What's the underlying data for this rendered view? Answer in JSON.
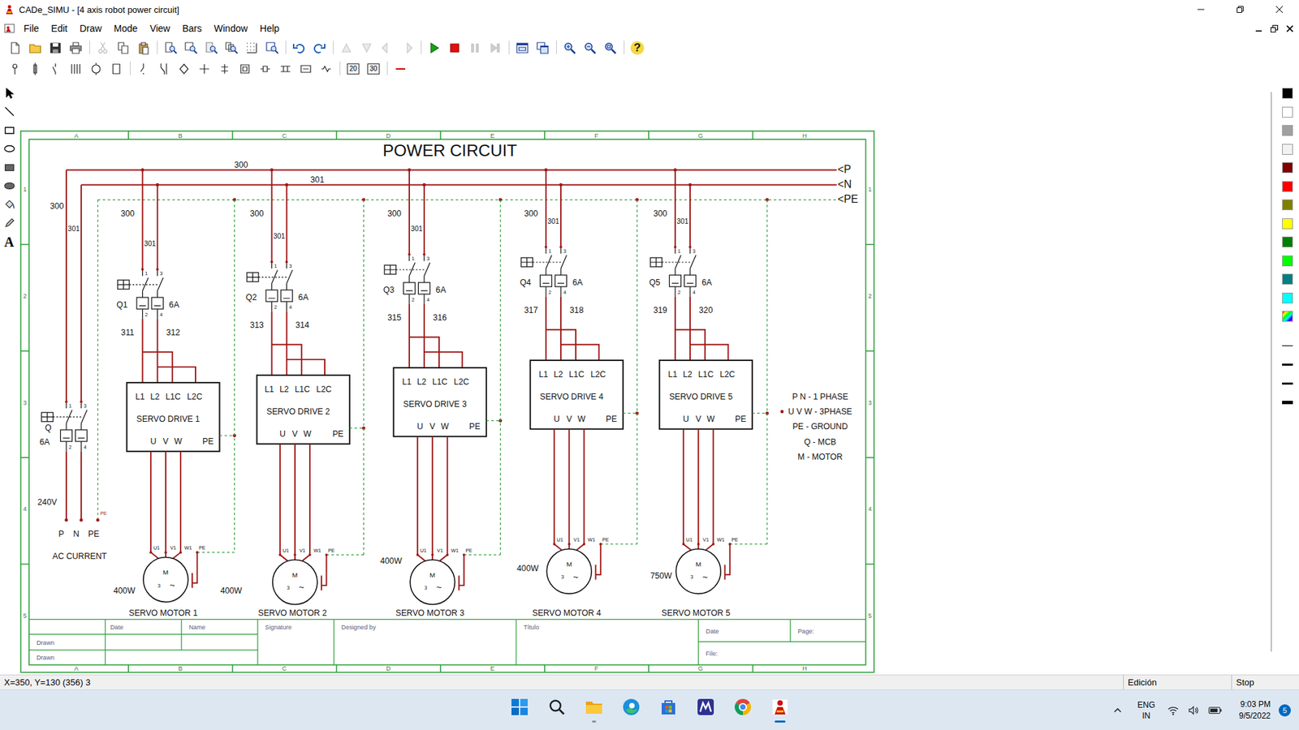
{
  "window": {
    "title": "CADe_SIMU - [4 axis robot power circuit]"
  },
  "menu": [
    "File",
    "Edit",
    "Draw",
    "Mode",
    "View",
    "Bars",
    "Window",
    "Help"
  ],
  "toolbar_main": [
    {
      "disabled": false
    },
    {
      "disabled": false
    },
    {
      "disabled": false
    },
    {
      "disabled": false
    },
    {
      "disabled": true
    },
    {
      "disabled": false
    },
    {
      "disabled": false
    },
    {
      "disabled": false
    },
    {
      "disabled": false
    },
    {
      "disabled": false
    },
    {
      "disabled": false
    },
    {
      "disabled": false
    },
    {
      "disabled": false
    },
    {
      "disabled": false
    },
    {
      "disabled": false
    },
    {
      "disabled": true
    },
    {
      "disabled": true
    },
    {
      "disabled": true
    },
    {
      "disabled": true
    },
    {
      "disabled": false
    },
    {
      "disabled": false
    },
    {
      "disabled": true
    },
    {
      "disabled": true
    },
    {
      "disabled": false
    },
    {
      "disabled": false
    },
    {
      "disabled": false
    },
    {
      "disabled": false
    },
    {
      "disabled": false
    },
    {
      "disabled": false
    }
  ],
  "help_glyph": "?",
  "view_buttons": [
    "20",
    "30"
  ],
  "tools": {
    "text_tool": "A"
  },
  "palette": {
    "colors": [
      "#000000",
      "#ffffff",
      "#a0a0a0",
      "#f2f2f2",
      "#800000",
      "#ff0000",
      "#808000",
      "#ffff00",
      "#008000",
      "#00ff00",
      "#008080",
      "#00ffff"
    ],
    "line_thickness": [
      1,
      2,
      3,
      4
    ]
  },
  "diagram": {
    "title": "POWER CIRCUIT",
    "columns": [
      "A",
      "B",
      "C",
      "D",
      "E",
      "F",
      "G",
      "H"
    ],
    "rows": [
      "1",
      "2",
      "3",
      "4",
      "5"
    ],
    "buses": [
      "<P",
      "<N",
      "<PE"
    ],
    "bus_wires": [
      "300",
      "301"
    ],
    "supply": {
      "breaker": "Q",
      "rating": "6A",
      "terminals": [
        "1",
        "3",
        "2",
        "4"
      ],
      "wires": [
        "300",
        "301"
      ],
      "voltage": "240V",
      "pe_tag": "PE",
      "pins": [
        "P",
        "N",
        "PE"
      ],
      "caption": "AC CURRENT"
    },
    "drives": [
      {
        "breaker": "Q1",
        "rating": "6A",
        "terminals": [
          "1",
          "3",
          "2",
          "4"
        ],
        "in_wires": [
          "300",
          "301"
        ],
        "out_wires": [
          "311",
          "312"
        ],
        "inputs": [
          "L1",
          "L2",
          "L1C",
          "L2C"
        ],
        "name": "SERVO DRIVE 1",
        "outputs": [
          "U",
          "V",
          "W"
        ],
        "pe": "PE",
        "motor": {
          "pins": [
            "U1",
            "V1",
            "W1",
            "PE"
          ],
          "symbol": [
            "M",
            "3",
            "~"
          ],
          "power": "400W",
          "name": "SERVO MOTOR 1"
        }
      },
      {
        "breaker": "Q2",
        "rating": "6A",
        "terminals": [
          "1",
          "3",
          "2",
          "4"
        ],
        "in_wires": [
          "300",
          "301"
        ],
        "out_wires": [
          "313",
          "314"
        ],
        "inputs": [
          "L1",
          "L2",
          "L1C",
          "L2C"
        ],
        "name": "SERVO DRIVE 2",
        "outputs": [
          "U",
          "V",
          "W"
        ],
        "pe": "PE",
        "motor": {
          "pins": [
            "U1",
            "V1",
            "W1",
            "PE"
          ],
          "symbol": [
            "M",
            "3",
            "~"
          ],
          "power": "400W",
          "name": "SERVO MOTOR 2"
        }
      },
      {
        "breaker": "Q3",
        "rating": "6A",
        "terminals": [
          "1",
          "3",
          "2",
          "4"
        ],
        "in_wires": [
          "300",
          "301"
        ],
        "out_wires": [
          "315",
          "316"
        ],
        "inputs": [
          "L1",
          "L2",
          "L1C",
          "L2C"
        ],
        "name": "SERVO DRIVE 3",
        "outputs": [
          "U",
          "V",
          "W"
        ],
        "pe": "PE",
        "motor": {
          "pins": [
            "U1",
            "V1",
            "W1",
            "PE"
          ],
          "symbol": [
            "M",
            "3",
            "~"
          ],
          "power": "400W",
          "name": "SERVO MOTOR 3"
        }
      },
      {
        "breaker": "Q4",
        "rating": "6A",
        "terminals": [
          "1",
          "3",
          "2",
          "4"
        ],
        "in_wires": [
          "300",
          "301"
        ],
        "out_wires": [
          "317",
          "318"
        ],
        "inputs": [
          "L1",
          "L2",
          "L1C",
          "L2C"
        ],
        "name": "SERVO DRIVE 4",
        "outputs": [
          "U",
          "V",
          "W"
        ],
        "pe": "PE",
        "motor": {
          "pins": [
            "U1",
            "V1",
            "W1",
            "PE"
          ],
          "symbol": [
            "M",
            "3",
            "~"
          ],
          "power": "400W",
          "name": "SERVO MOTOR 4"
        }
      },
      {
        "breaker": "Q5",
        "rating": "6A",
        "terminals": [
          "1",
          "3",
          "2",
          "4"
        ],
        "in_wires": [
          "300",
          "301"
        ],
        "out_wires": [
          "319",
          "320"
        ],
        "inputs": [
          "L1",
          "L2",
          "L1C",
          "L2C"
        ],
        "name": "SERVO DRIVE 5",
        "outputs": [
          "U",
          "V",
          "W"
        ],
        "pe": "PE",
        "motor": {
          "pins": [
            "U1",
            "V1",
            "W1",
            "PE"
          ],
          "symbol": [
            "M",
            "3",
            "~"
          ],
          "power": "750W",
          "name": "SERVO MOTOR 5"
        }
      }
    ],
    "legend": [
      "P N - 1 PHASE",
      "U V W - 3PHASE",
      "PE - GROUND",
      "Q - MCB",
      "M - MOTOR"
    ],
    "title_block": {
      "headers": [
        "Date",
        "Name"
      ],
      "rows": [
        "Drawn",
        "Drawn"
      ],
      "fields": [
        "Signature",
        "Designed by",
        "Título"
      ],
      "right": [
        "Date",
        "Page:",
        "File:"
      ]
    }
  },
  "status_bar": {
    "coords": "X=350, Y=130 (356) 3",
    "mode": "Edición",
    "sim_state": "Stop"
  },
  "taskbar": {
    "apps": [
      {
        "running": false,
        "active": false
      },
      {
        "running": false,
        "active": false
      },
      {
        "running": true,
        "active": false
      },
      {
        "running": false,
        "active": false
      },
      {
        "running": false,
        "active": false
      },
      {
        "running": false,
        "active": false
      },
      {
        "running": false,
        "active": false
      },
      {
        "running": true,
        "active": true
      }
    ],
    "language": [
      "ENG",
      "IN"
    ],
    "time": "9:03 PM",
    "date": "9/5/2022",
    "notifications": "5"
  }
}
